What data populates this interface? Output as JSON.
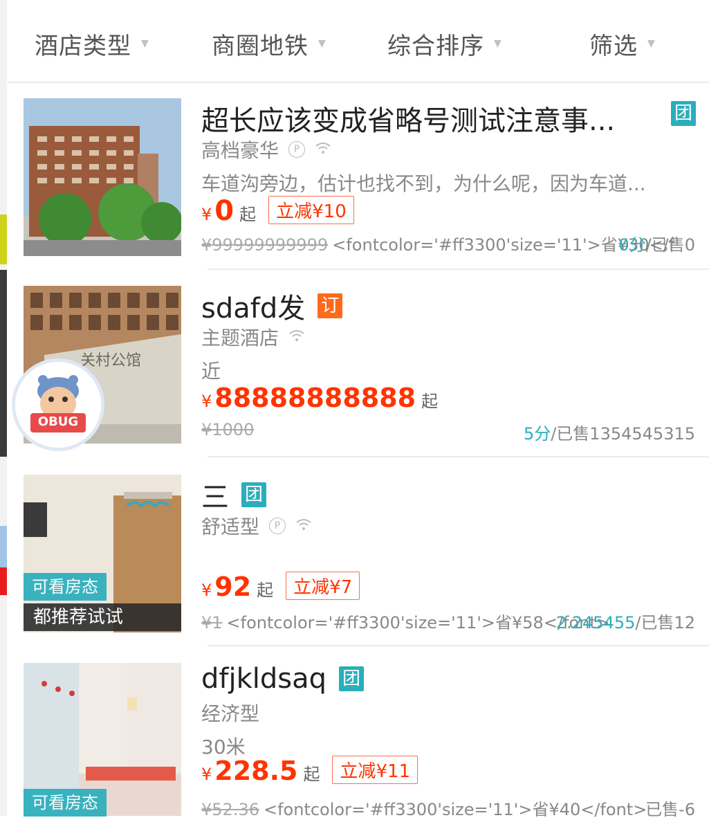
{
  "filters": [
    {
      "label": "酒店类型"
    },
    {
      "label": "商圈地铁"
    },
    {
      "label": "综合排序"
    },
    {
      "label": "筛选"
    }
  ],
  "hotels": [
    {
      "name": "超长应该变成省略号测试注意事...",
      "badge": "团",
      "type": "高档豪华",
      "icons": [
        "parking-icon",
        "wifi-icon"
      ],
      "desc": "车道沟旁边，估计也找不到，为什么呢，因为车道...",
      "currency": "¥",
      "price": "0",
      "qi": "起",
      "discount": "立减¥10",
      "original_price": "¥99999999999",
      "raw_html": "<fontcolor='#ff3300'size='11'>省¥30</f",
      "score": "0分",
      "sold": "/已售0"
    },
    {
      "name": "sdafd发",
      "badge": "订",
      "type": "主题酒店",
      "icons": [
        "wifi-icon"
      ],
      "desc": "近",
      "currency": "¥",
      "price": "88888888888",
      "qi": "起",
      "original_price": "¥1000",
      "score": "5分",
      "sold": "/已售1354545315"
    },
    {
      "name": "三",
      "badge": "团",
      "type": "舒适型",
      "icons": [
        "parking-icon",
        "wifi-icon"
      ],
      "currency": "¥",
      "price": "92",
      "qi": "起",
      "discount": "立减¥7",
      "original_price": "¥1",
      "raw_html": "<fontcolor='#ff3300'size='11'>省¥58</font>",
      "score": "2.245455",
      "sold": "/已售12",
      "room_tag": "可看房态",
      "recommend": "都推荐试试"
    },
    {
      "name": "dfjkldsaq",
      "badge": "团",
      "type": "经济型",
      "desc": "30米",
      "currency": "¥",
      "price": "228.5",
      "qi": "起",
      "discount": "立减¥11",
      "original_price": "¥52.36",
      "raw_html": "<fontcolor='#ff3300'size='11'>省¥40</font>",
      "sold": "已售-6",
      "room_tag": "可看房态"
    }
  ],
  "obug": {
    "label": "OBUG"
  },
  "colors": {
    "accent": "#2aaebc",
    "price": "#ff3300",
    "badge_ding": "#ff6a1a"
  }
}
